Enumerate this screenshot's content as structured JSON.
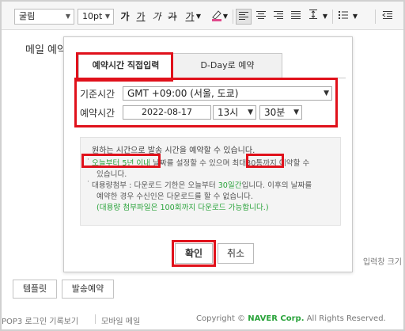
{
  "toolbar": {
    "font_family": "굴림",
    "font_size": "10pt",
    "bold": "가",
    "underline": "가",
    "italic": "가",
    "strike": "가",
    "font_color": "가"
  },
  "editor": {
    "text": "메일 예약",
    "input_size_label": "입력창 크기"
  },
  "dialog": {
    "tabs": [
      "예약시간 직접입력",
      "D-Day로 예약"
    ],
    "timezone_label": "기준시간",
    "timezone_value": "GMT +09:00 (서울, 도쿄)",
    "schedule_label": "예약시간",
    "date_value": "2022-08-17",
    "hour_value": "13시",
    "minute_value": "30분",
    "notice": {
      "title": "원하는 시간으로 발송 시간을 예약할 수 있습니다.",
      "line1_a": "오늘부터 5년 이내",
      "line1_b": " 날짜를 설정할 수 있으며",
      "line1_c": "최대30통",
      "line1_d": "까지 예약할 수",
      "line2": "있습니다.",
      "line3_a": "대용량첨부 : 다운로드 기한은 오늘부터 ",
      "line3_b": "30일간",
      "line3_c": "입니다. 이후의 날짜를",
      "line4": "예약한 경우 수신인은 다운로드를 할 수 없습니다.",
      "line5": "(대용량 첨부파일은 100회까지 다운로드 가능합니다.)"
    },
    "ok_label": "확인",
    "cancel_label": "취소"
  },
  "bottom": {
    "template_label": "템플릿",
    "scheduled_send_label": "발송예약"
  },
  "footer": {
    "pop3": "POP3 로그인 기록보기",
    "mobile": "모바일 메일",
    "copyright_a": "Copyright © ",
    "copyright_b": "NAVER Corp.",
    "copyright_c": " All Rights Reserved."
  },
  "colors": {
    "highlight": "#e0111b",
    "green": "#2aa33b"
  }
}
